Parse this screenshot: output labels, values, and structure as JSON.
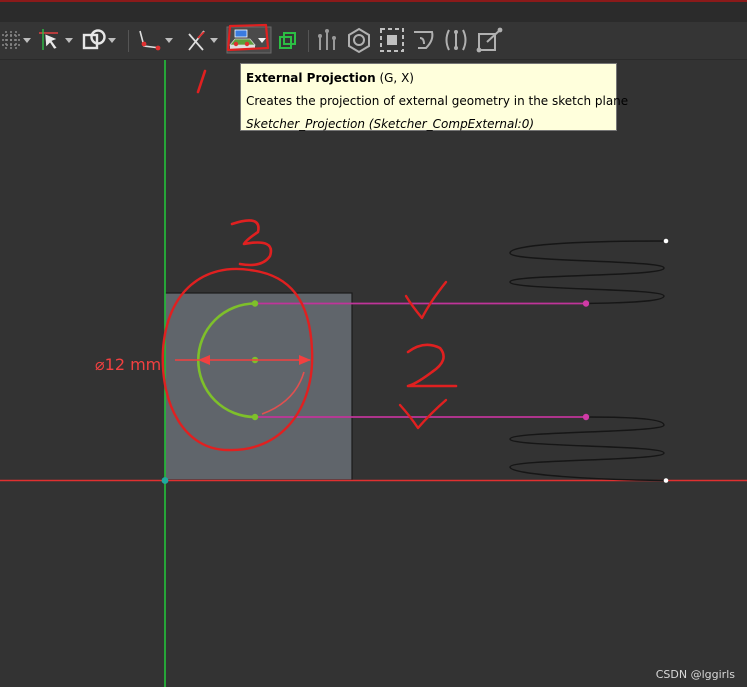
{
  "tooltip": {
    "title": "External Projection",
    "shortcut": "(G, X)",
    "description": "Creates the projection of external geometry in the sketch plane",
    "command": "Sketcher_Projection (Sketcher_CompExternal:0)"
  },
  "dimension": {
    "label": "⌀12 mm"
  },
  "annotations": {
    "mark_1": "1",
    "mark_2": "2",
    "mark_3": "3"
  },
  "toolbar": {
    "icons": [
      "grid-icon",
      "select-constraint-icon",
      "union-icon",
      "line-tool-icon",
      "trim-icon",
      "external-projection-icon",
      "carbon-copy-icon",
      "constraint-horizontal-icon",
      "constraint-coincident-icon",
      "constraint-block-icon",
      "constraint-tangent-icon",
      "constraint-parallel-icon",
      "constraint-point-icon"
    ]
  },
  "colors": {
    "background": "#333333",
    "toolbar": "#353535",
    "axis_vertical": "#23c23a",
    "axis_horizontal": "#e03030",
    "body_face": "#60656b",
    "arc": "#7ec02a",
    "projection_line": "#c0349a",
    "annotation": "#e02020",
    "dimension": "#f24040"
  },
  "watermark": "CSDN @lggirls"
}
